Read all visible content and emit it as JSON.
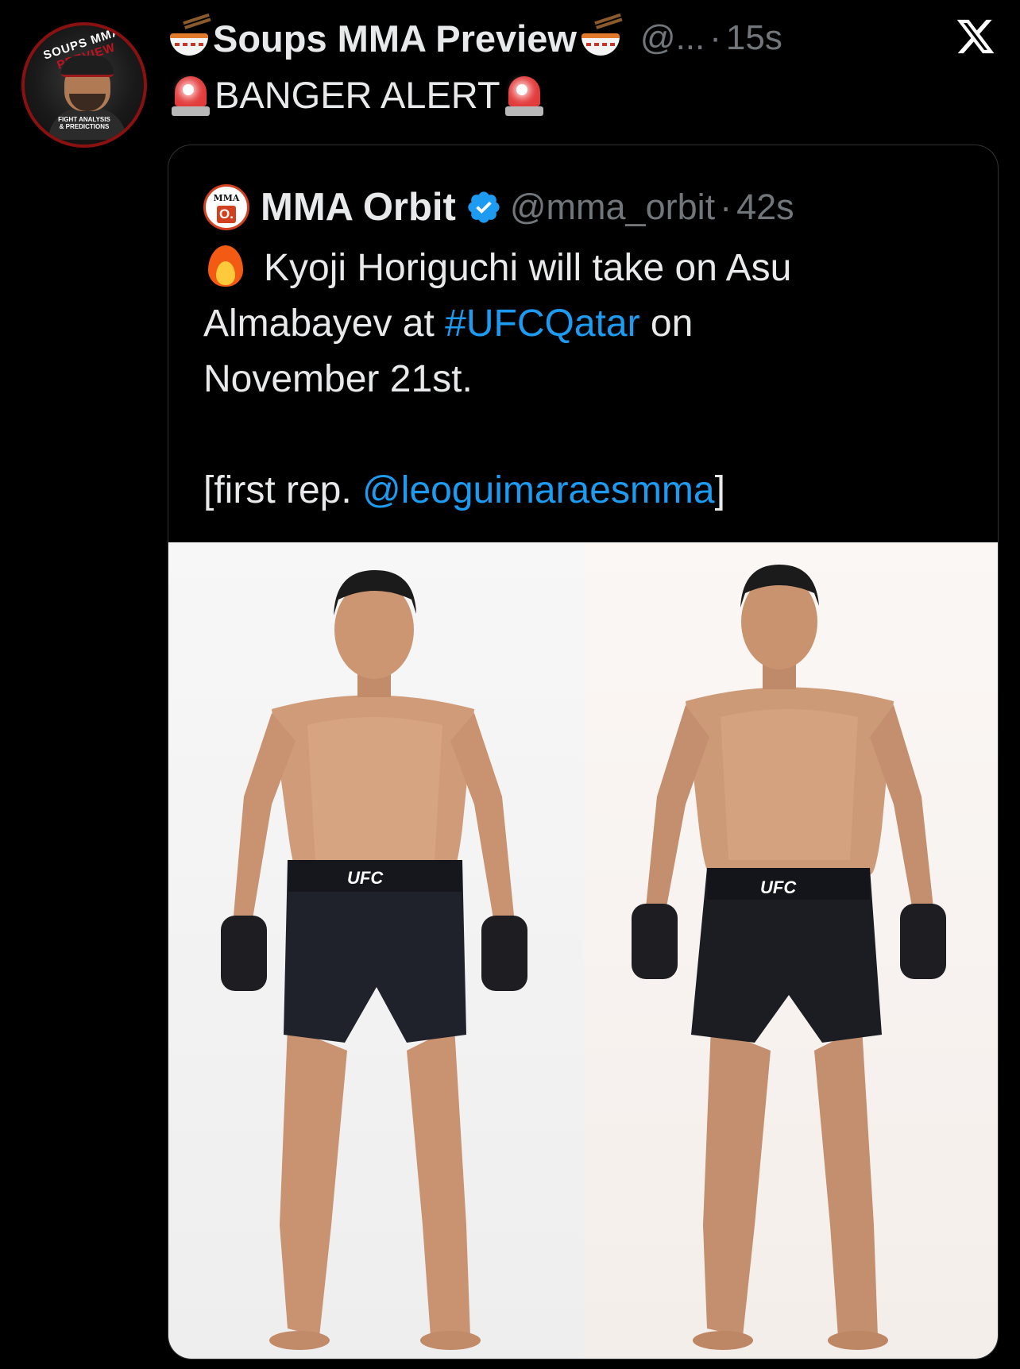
{
  "tweet": {
    "display_name": "Soups MMA Preview",
    "handle": "@...",
    "separator": "·",
    "time": "15s",
    "text": "BANGER ALERT",
    "avatar": {
      "ring_text_a": "SOUPS MMA ",
      "ring_text_b": "PREVIEW",
      "badge_line1": "FIGHT ANALYSIS",
      "badge_line2": "& PREDICTIONS"
    },
    "name_emoji": "soup-bowl-icon",
    "text_emoji": "siren-icon"
  },
  "quoted": {
    "avatar": {
      "top": "MMA",
      "letter": "O."
    },
    "display_name": "MMA Orbit",
    "handle": "@mma_orbit",
    "separator": "·",
    "time": "42s",
    "line1": "Kyoji Horiguchi will take on Asu",
    "line2_a": "Almabayev at ",
    "line2_hashtag": "#UFCQatar",
    "line2_b": " on",
    "line3": "November 21st.",
    "line4_a": "[first rep. ",
    "line4_mention": "@leoguimaraesmma",
    "line4_b": "]",
    "media": {
      "left_shorts_text": "UFC",
      "right_shorts_text": "UFC"
    }
  },
  "colors": {
    "background": "#000000",
    "text": "#e7e9ea",
    "muted": "#71767b",
    "link": "#1d9bf0",
    "border": "#2f3336"
  }
}
